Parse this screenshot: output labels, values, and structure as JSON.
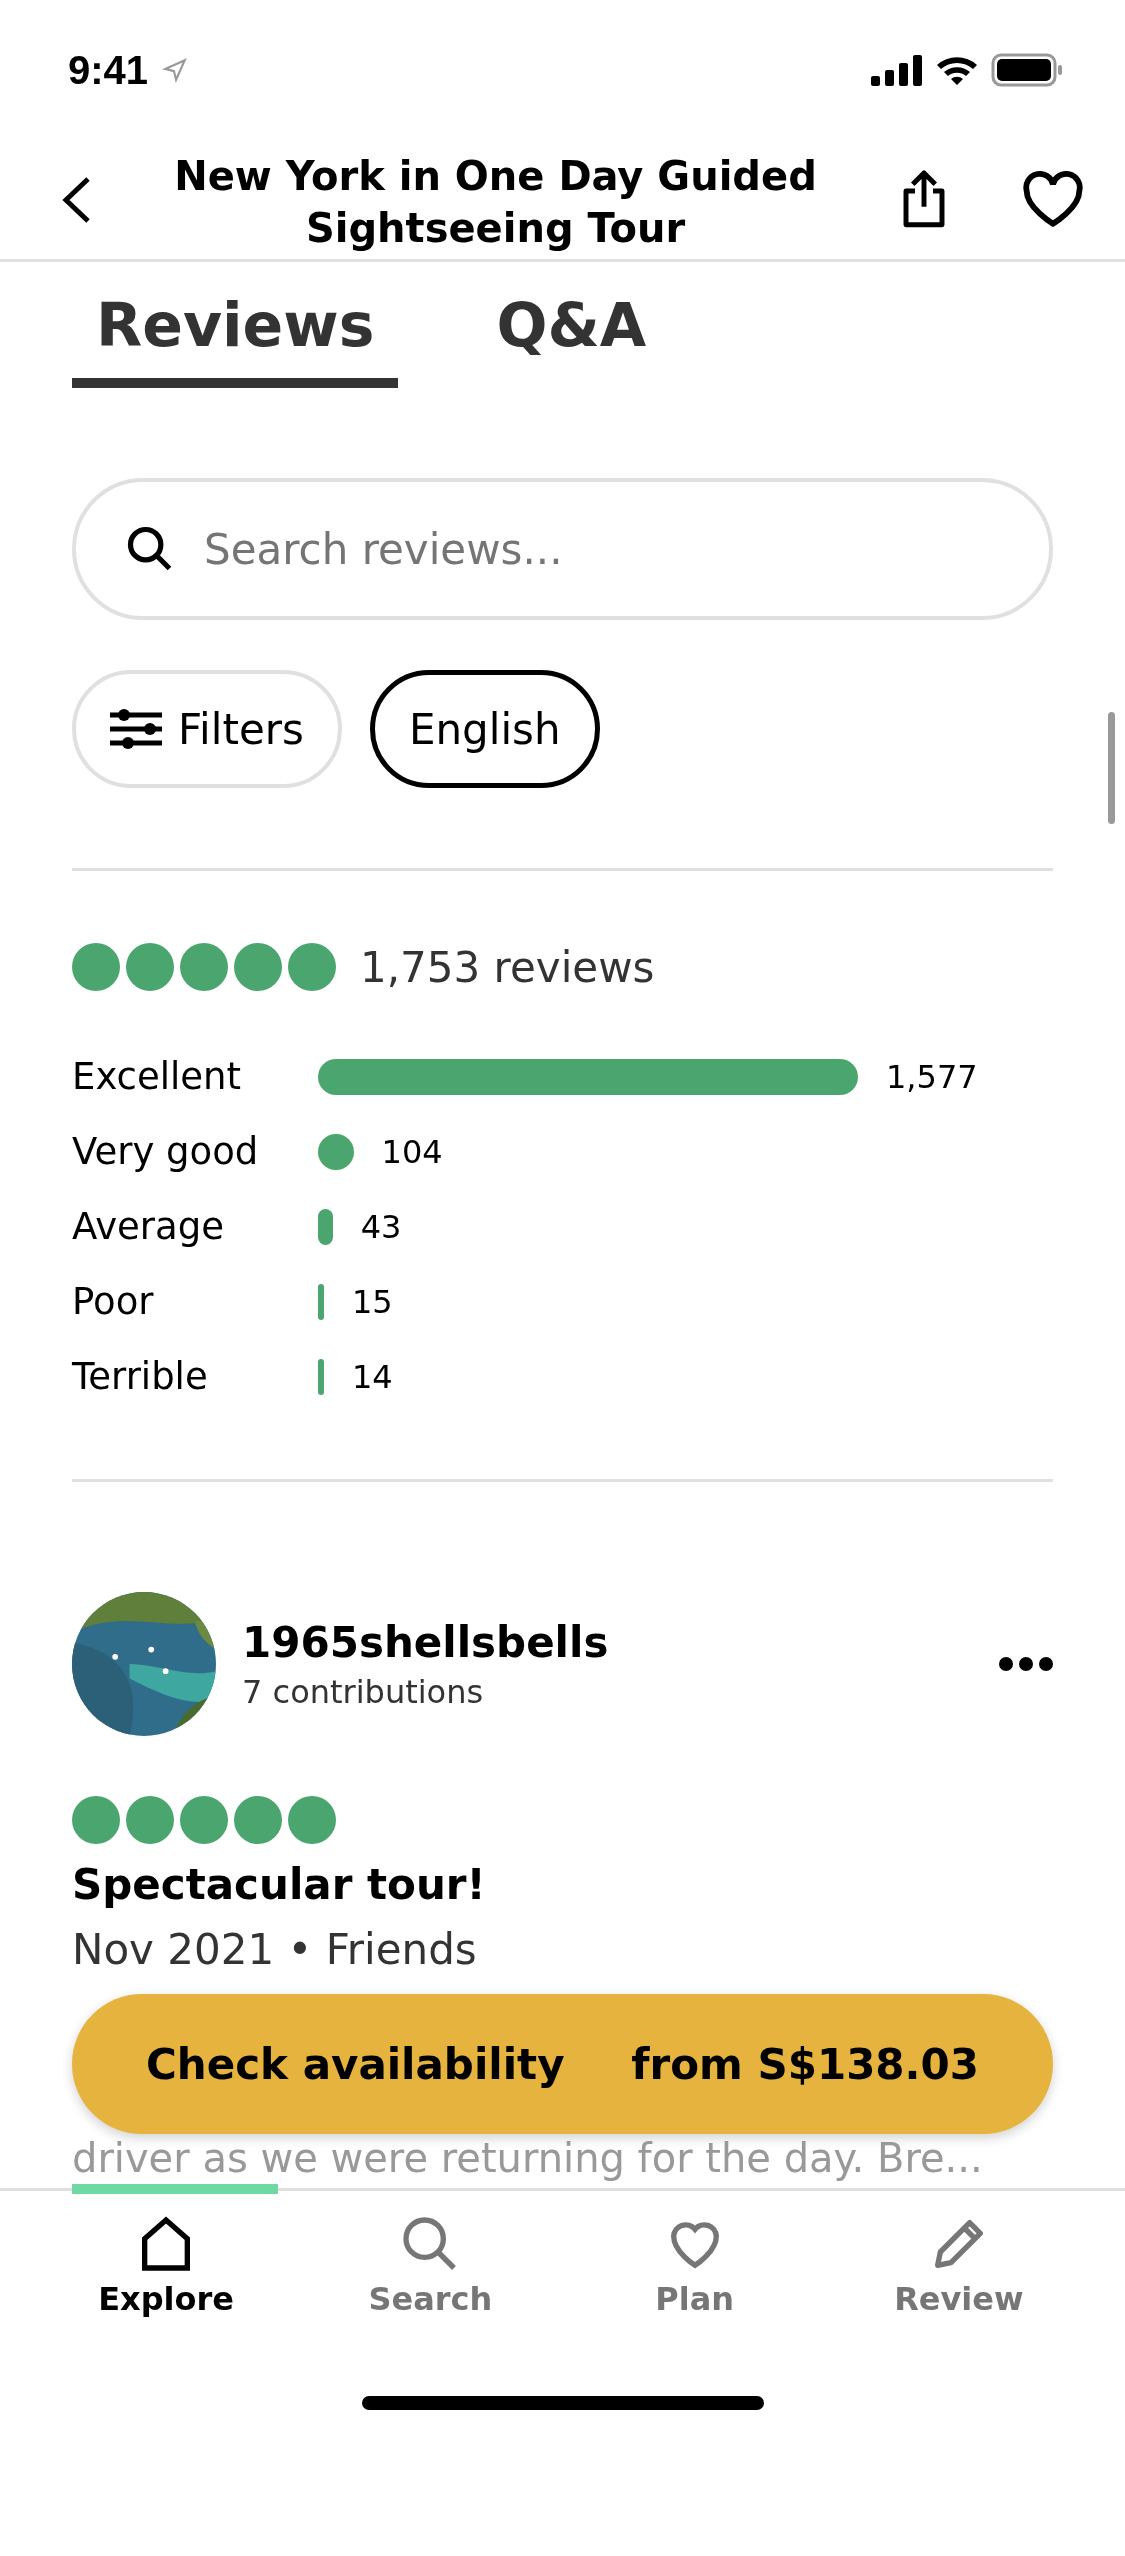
{
  "status_bar": {
    "time": "9:41"
  },
  "header": {
    "title": "New York in One Day Guided Sightseeing Tour"
  },
  "tabs": [
    {
      "label": "Reviews",
      "selected": true
    },
    {
      "label": "Q&A",
      "selected": false
    }
  ],
  "search": {
    "placeholder": "Search reviews..."
  },
  "chips": [
    {
      "label": "Filters",
      "kind": "filter",
      "selected": false
    },
    {
      "label": "English",
      "kind": "plain",
      "selected": true
    }
  ],
  "summary": {
    "stars": 5,
    "count": "1,753 reviews"
  },
  "breakdown": [
    {
      "label": "Excellent",
      "count": "1,577"
    },
    {
      "label": "Very good",
      "count": "104"
    },
    {
      "label": "Average",
      "count": "43"
    },
    {
      "label": "Poor",
      "count": "15"
    },
    {
      "label": "Terrible",
      "count": "14"
    }
  ],
  "review": {
    "author": "1965shellsbells",
    "contributions": "7 contributions",
    "stars": 5,
    "title": "Spectacular tour!",
    "meta": "Nov 2021 • Friends",
    "excerpt": "driver as we were returning for the day. Bre..."
  },
  "cta": {
    "label": "Check availability",
    "price": "from S$138.03"
  },
  "reading_progress": {
    "level": 0.21
  },
  "nav": [
    {
      "label": "Explore",
      "kind": "home",
      "selected": true
    },
    {
      "label": "Search",
      "kind": "search",
      "selected": false
    },
    {
      "label": "Plan",
      "kind": "heart",
      "selected": false
    },
    {
      "label": "Review",
      "kind": "pencil",
      "selected": false
    }
  ]
}
